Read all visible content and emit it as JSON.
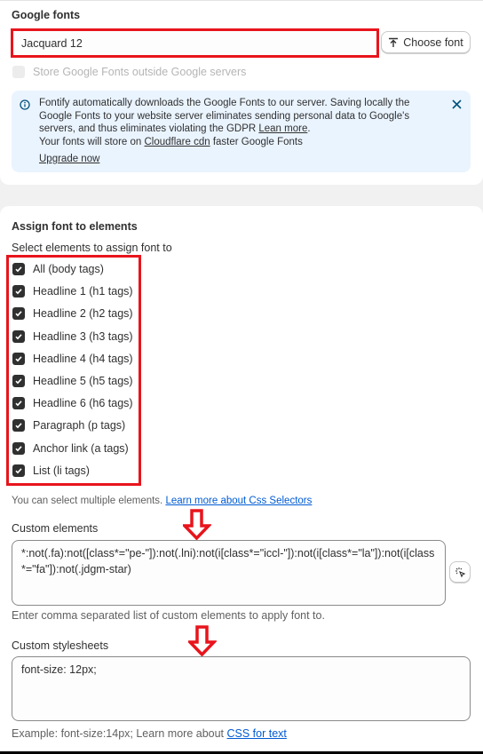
{
  "google_fonts": {
    "title": "Google fonts",
    "font_value": "Jacquard 12",
    "choose_font_label": "Choose font",
    "store_outside_label": "Store Google Fonts outside Google servers",
    "store_outside_checked": false,
    "banner": {
      "text_1": "Fontify automatically downloads the Google Fonts to our server. Saving locally the Google Fonts to your website server eliminates sending personal data to Google's servers, and thus eliminates violating the GDPR ",
      "lean_more": "Lean more",
      "text_2": ".",
      "text_3": "Your fonts will store on ",
      "cloudflare": "Cloudflare cdn",
      "text_4": " faster Google Fonts",
      "upgrade": "Upgrade now"
    }
  },
  "assign": {
    "title": "Assign font to elements",
    "subtitle": "Select elements to assign font to",
    "items": [
      {
        "label": "All (body tags)",
        "checked": true
      },
      {
        "label": "Headline 1 (h1 tags)",
        "checked": true
      },
      {
        "label": "Headline 2 (h2 tags)",
        "checked": true
      },
      {
        "label": "Headline 3 (h3 tags)",
        "checked": true
      },
      {
        "label": "Headline 4 (h4 tags)",
        "checked": true
      },
      {
        "label": "Headline 5 (h5 tags)",
        "checked": true
      },
      {
        "label": "Headline 6 (h6 tags)",
        "checked": true
      },
      {
        "label": "Paragraph (p tags)",
        "checked": true
      },
      {
        "label": "Anchor link (a tags)",
        "checked": true
      },
      {
        "label": "List (li tags)",
        "checked": true
      }
    ],
    "multi_note": "You can select multiple elements. ",
    "css_selectors_link": "Learn more about Css Selectors",
    "custom_elements_label": "Custom elements",
    "custom_elements_value": "*:not(.fa):not([class*=\"pe-\"]):not(.lni):not(i[class*=\"iccl-\"]):not(i[class*=\"la\"]):not(i[class*=\"fa\"]):not(.jdgm-star)",
    "custom_elements_help": "Enter comma separated list of custom elements to apply font to.",
    "custom_stylesheets_label": "Custom stylesheets",
    "custom_stylesheets_value": "font-size: 12px;",
    "example_text": "Example: font-size:14px; Learn more about ",
    "css_text_link": "CSS for text"
  },
  "colors": {
    "annotation_red": "#e8141c",
    "link_blue": "#005bd3",
    "banner_bg": "#eaf4ff"
  }
}
